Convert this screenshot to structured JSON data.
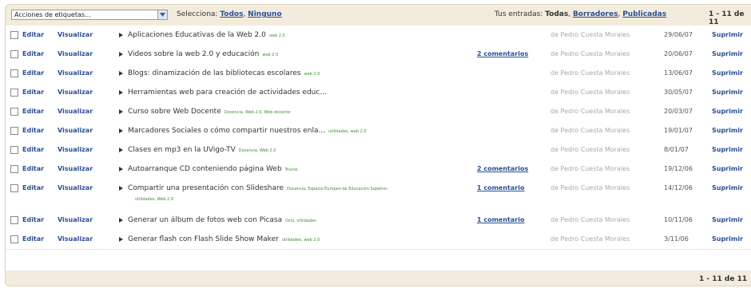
{
  "toolbar": {
    "select_value": "Acciones de etiquetas...",
    "selecciona_label": "Selecciona:",
    "todos": "Todos",
    "ninguno": "Ninguno",
    "tus_entradas_label": "Tus entradas:",
    "todas": "Todas",
    "borradores": "Borradores",
    "publicadas": "Publicadas",
    "count": "1 - 11 de 11"
  },
  "actions": {
    "edit": "Editar",
    "view": "Visualizar",
    "delete": "Suprimir"
  },
  "posts": [
    {
      "title": "Aplicaciones Educativas de la Web 2.0",
      "tags": "web 2.0",
      "comments": "",
      "author": "de Pedro Cuesta Morales",
      "date": "29/06/07"
    },
    {
      "title": "Videos sobre la web 2.0 y educación",
      "tags": "web 2.0",
      "comments": "2 comentarios",
      "author": "de Pedro Cuesta Morales",
      "date": "20/06/07"
    },
    {
      "title": "Blogs: dinamización de las bibliotecas escolares",
      "tags": "web 2.0",
      "comments": "",
      "author": "de Pedro Cuesta Morales",
      "date": "13/06/07"
    },
    {
      "title": "Herramientas web para creación de actividades educ...",
      "tags": "",
      "comments": "",
      "author": "de Pedro Cuesta Morales",
      "date": "30/05/07"
    },
    {
      "title": "Curso sobre Web Docente",
      "tags": "Docencia, Web 2.0, Web docente",
      "comments": "",
      "author": "de Pedro Cuesta Morales",
      "date": "20/03/07"
    },
    {
      "title": "Marcadores Sociales o cómo compartir nuestros enla...",
      "tags": "utilidades, web 2.0",
      "comments": "",
      "author": "de Pedro Cuesta Morales",
      "date": "19/01/07"
    },
    {
      "title": "Clases en mp3 en la UVigo-TV",
      "tags": "Docencia, Web 2.0",
      "comments": "",
      "author": "de Pedro Cuesta Morales",
      "date": "8/01/07"
    },
    {
      "title": "Autoarranque CD conteniendo página Web",
      "tags": "Trucos",
      "comments": "2 comentarios",
      "author": "de Pedro Cuesta Morales",
      "date": "19/12/06"
    },
    {
      "title": "Compartir una presentación con Slideshare",
      "tags": "Docencia, Espacio Europeo de Educación Superior,",
      "tags2": "utilidades, Web 2.0",
      "comments": "1 comentario",
      "author": "de Pedro Cuesta Morales",
      "date": "14/12/06"
    },
    {
      "title": "Generar un álbum de fotos web con Picasa",
      "tags": "Ocio, utilidades",
      "comments": "1 comentario",
      "author": "de Pedro Cuesta Morales",
      "date": "10/11/06"
    },
    {
      "title": "Generar flash con Flash Slide Show Maker",
      "tags": "utilidades, web 2.0",
      "comments": "",
      "author": "de Pedro Cuesta Morales",
      "date": "3/11/06"
    }
  ],
  "footer": {
    "count": "1 - 11 de 11"
  }
}
